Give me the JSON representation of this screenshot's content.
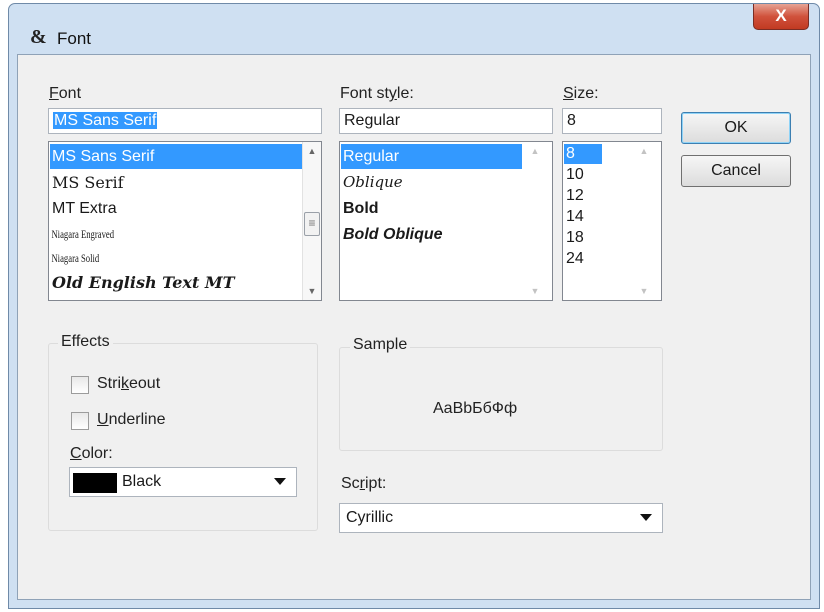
{
  "window": {
    "title": "Font",
    "close_glyph": "X",
    "title_icon": "font-dialog-icon"
  },
  "font": {
    "label_prefix": "",
    "label_key": "F",
    "label_rest": "ont",
    "input_value": "MS Sans Serif",
    "items": [
      "MS Sans Serif",
      "MS Serif",
      "MT Extra",
      "Niagara Engraved",
      "Niagara Solid",
      "Old English Text MT"
    ],
    "selected": "MS Sans Serif"
  },
  "font_style": {
    "label_prefix": "Font st",
    "label_key": "y",
    "label_rest": "le:",
    "input_value": "Regular",
    "items": [
      "Regular",
      "Oblique",
      "Bold",
      "Bold Oblique"
    ],
    "selected": "Regular"
  },
  "size": {
    "label_prefix": "",
    "label_key": "S",
    "label_rest": "ize:",
    "input_value": "8",
    "items": [
      "8",
      "10",
      "12",
      "14",
      "18",
      "24"
    ],
    "selected": "8"
  },
  "buttons": {
    "ok": "OK",
    "cancel": "Cancel"
  },
  "effects": {
    "label": "Effects",
    "strikeout_prefix": "Stri",
    "strikeout_key": "k",
    "strikeout_rest": "eout",
    "underline_prefix": "",
    "underline_key": "U",
    "underline_rest": "nderline",
    "strikeout_checked": false,
    "underline_checked": false,
    "color_label_prefix": "",
    "color_label_key": "C",
    "color_label_rest": "olor:",
    "color_value": "Black",
    "color_hex": "#000000"
  },
  "sample": {
    "label": "Sample",
    "text": "AaBbБбФф"
  },
  "script": {
    "label_prefix": "Sc",
    "label_key": "r",
    "label_rest": "ipt:",
    "value": "Cyrillic"
  },
  "colors": {
    "selection": "#3399ff",
    "window_frame": "#cfe0f2",
    "dialog_bg": "#f0f0f0",
    "close_button": "#c13a22"
  }
}
